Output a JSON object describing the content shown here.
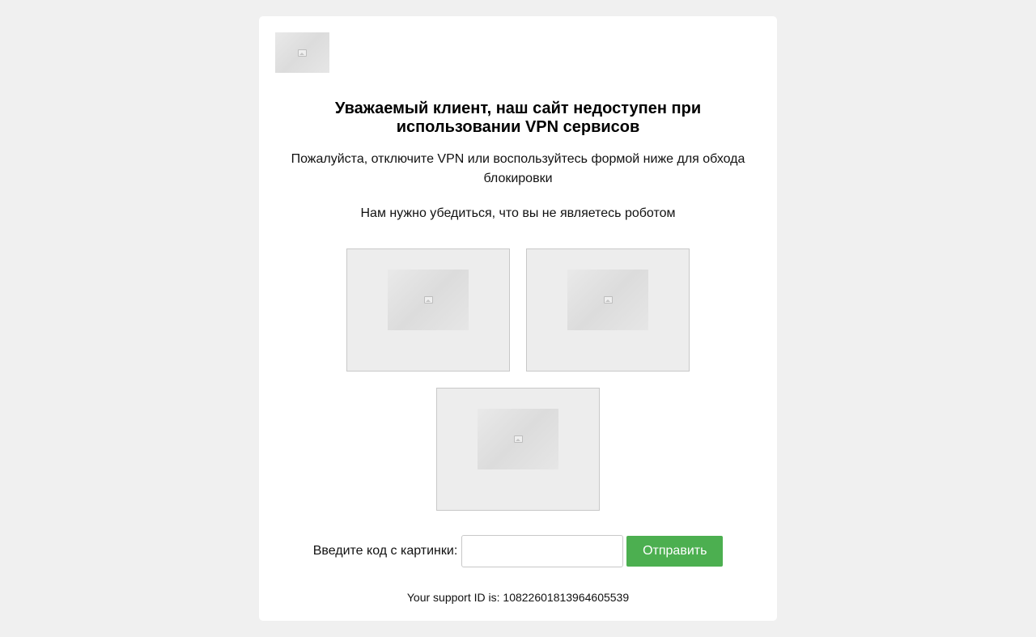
{
  "page": {
    "title": "Уважаемый клиент, наш сайт недоступен при использовании VPN сервисов",
    "subtitle": "Пожалуйста, отключите VPN или воспользуйтесь формой ниже для обхода блокировки",
    "robot_check": "Нам нужно убедиться, что вы не являетесь роботом"
  },
  "icons": {
    "logo": "broken-image-icon",
    "captcha_image": "broken-image-icon"
  },
  "form": {
    "label": "Введите код с картинки:",
    "input_value": "",
    "input_placeholder": "",
    "submit_label": "Отправить"
  },
  "footer": {
    "support_id_text": "Your support ID is: 10822601813964605539"
  },
  "colors": {
    "background": "#f0f0f0",
    "card": "#ffffff",
    "submit_button": "#4caf50",
    "captcha_box": "#ededed"
  }
}
